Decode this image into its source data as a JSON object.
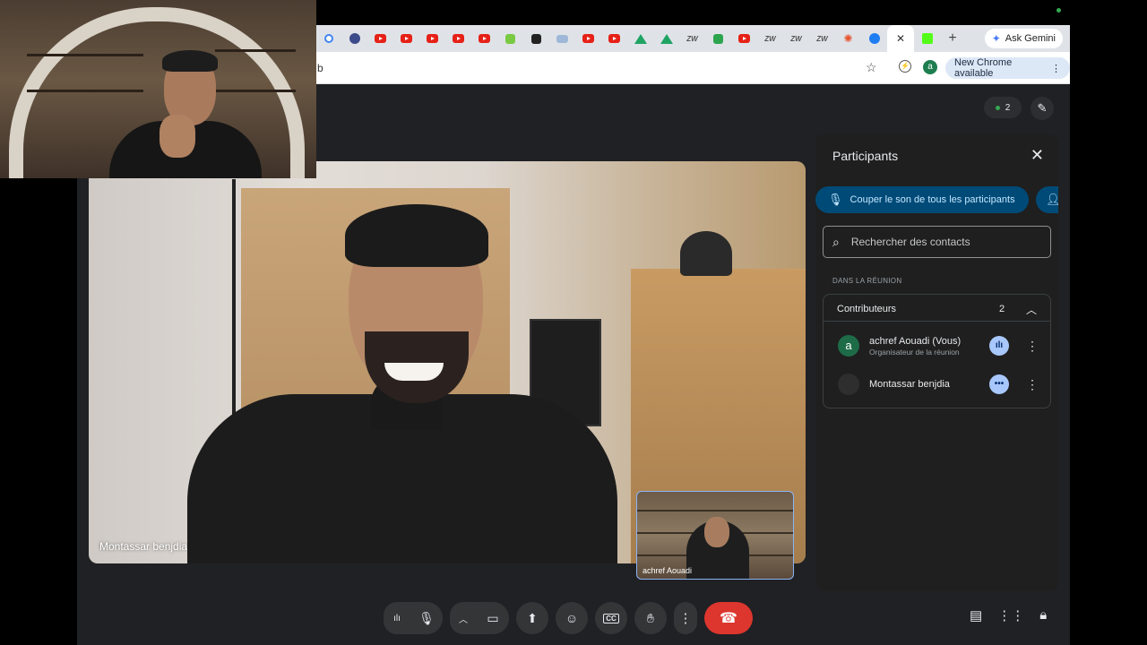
{
  "browser": {
    "tabs": [
      {
        "icon": "google-icon",
        "color": "#4285f4"
      },
      {
        "icon": "avatar-icon",
        "color": "#3b4a8a"
      },
      {
        "icon": "youtube-icon",
        "color": "#e62117"
      },
      {
        "icon": "youtube-icon",
        "color": "#e62117"
      },
      {
        "icon": "youtube-icon",
        "color": "#e62117"
      },
      {
        "icon": "youtube-icon",
        "color": "#e62117"
      },
      {
        "icon": "youtube-icon",
        "color": "#e62117"
      },
      {
        "icon": "app-icon",
        "color": "#7ac943"
      },
      {
        "icon": "app-icon",
        "color": "#222222"
      },
      {
        "icon": "doc-icon",
        "color": "#9fb8d8"
      },
      {
        "icon": "youtube-icon",
        "color": "#e62117"
      },
      {
        "icon": "youtube-icon",
        "color": "#e62117"
      },
      {
        "icon": "drive-icon",
        "color": "#1fa463"
      },
      {
        "icon": "drive-icon",
        "color": "#1fa463"
      },
      {
        "icon": "zw-icon",
        "color": "#666666"
      },
      {
        "icon": "app-icon",
        "color": "#2da44e"
      },
      {
        "icon": "youtube-icon",
        "color": "#e62117"
      },
      {
        "icon": "zw-icon",
        "color": "#666666"
      },
      {
        "icon": "zw-icon",
        "color": "#666666"
      },
      {
        "icon": "zw-icon",
        "color": "#666666"
      },
      {
        "icon": "star-burst-icon",
        "color": "#e8542f"
      },
      {
        "icon": "messenger-icon",
        "color": "#1e7df2"
      }
    ],
    "active_tab_close": "✕",
    "kick_tab_color": "#53fc18",
    "new_tab": "+",
    "gemini_label": "Ask Gemini",
    "url_fragment": "b",
    "new_chrome_label": "New Chrome available",
    "profile_initial": "a"
  },
  "meet": {
    "participant_count": "2",
    "main_speaker_name": "Montassar benjdia",
    "self_view_name": "achref Aouadi",
    "panel": {
      "title": "Participants",
      "mute_all_label": "Couper le son de tous les participants",
      "search_placeholder": "Rechercher des contacts",
      "section_label": "DANS LA RÉUNION",
      "group_label": "Contributeurs",
      "group_count": "2",
      "participants": [
        {
          "initial": "a",
          "name": "achref Aouadi (Vous)",
          "role": "Organisateur de la réunion"
        },
        {
          "initial": "",
          "name": "Montassar benjdia",
          "role": ""
        }
      ]
    },
    "accent_color": "#004a77",
    "end_call_color": "#dc362e"
  }
}
